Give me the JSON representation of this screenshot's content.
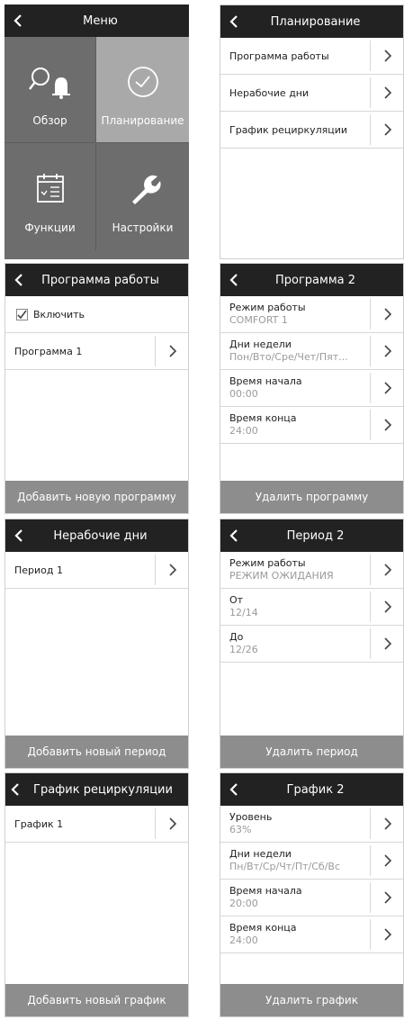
{
  "menu": {
    "title": "Меню",
    "tiles": [
      {
        "label": "Обзор"
      },
      {
        "label": "Планирование"
      },
      {
        "label": "Функции"
      },
      {
        "label": "Настройки"
      }
    ]
  },
  "planning": {
    "title": "Планирование",
    "items": [
      {
        "label": "Программа работы"
      },
      {
        "label": "Нерабочие дни"
      },
      {
        "label": "График рециркуляции"
      }
    ]
  },
  "work_program": {
    "title": "Программа работы",
    "enable_label": "Включить",
    "enable_checked": true,
    "items": [
      {
        "label": "Программа 1"
      }
    ],
    "footer": "Добавить новую программу"
  },
  "program2": {
    "title": "Программа 2",
    "items": [
      {
        "label": "Режим работы",
        "value": "COMFORT 1"
      },
      {
        "label": "Дни недели",
        "value": "Пон/Вто/Сре/Чет/Пят..."
      },
      {
        "label": "Время начала",
        "value": "00:00"
      },
      {
        "label": "Время конца",
        "value": "24:00"
      }
    ],
    "footer": "Удалить программу"
  },
  "holidays": {
    "title": "Нерабочие дни",
    "items": [
      {
        "label": "Период 1"
      }
    ],
    "footer": "Добавить новый период"
  },
  "period2": {
    "title": "Период 2",
    "items": [
      {
        "label": "Режим работы",
        "value": "РЕЖИМ ОЖИДАНИЯ"
      },
      {
        "label": "От",
        "value": "12/14"
      },
      {
        "label": "До",
        "value": "12/26"
      }
    ],
    "footer": "Удалить период"
  },
  "recirc": {
    "title": "График рециркуляции",
    "items": [
      {
        "label": "График 1"
      }
    ],
    "footer": "Добавить новый график"
  },
  "schedule2": {
    "title": "График 2",
    "items": [
      {
        "label": "Уровень",
        "value": "63%"
      },
      {
        "label": "Дни недели",
        "value": "Пн/Вт/Ср/Чт/Пт/Сб/Вс"
      },
      {
        "label": "Время начала",
        "value": "20:00"
      },
      {
        "label": "Время конца",
        "value": "24:00"
      }
    ],
    "footer": "Удалить график"
  },
  "colors": {
    "header": "#222222",
    "tile_dark": "#6d6d6d",
    "tile_light": "#a9a9a9",
    "footer": "#8d8d8d",
    "value_text": "#9a9a9a"
  }
}
